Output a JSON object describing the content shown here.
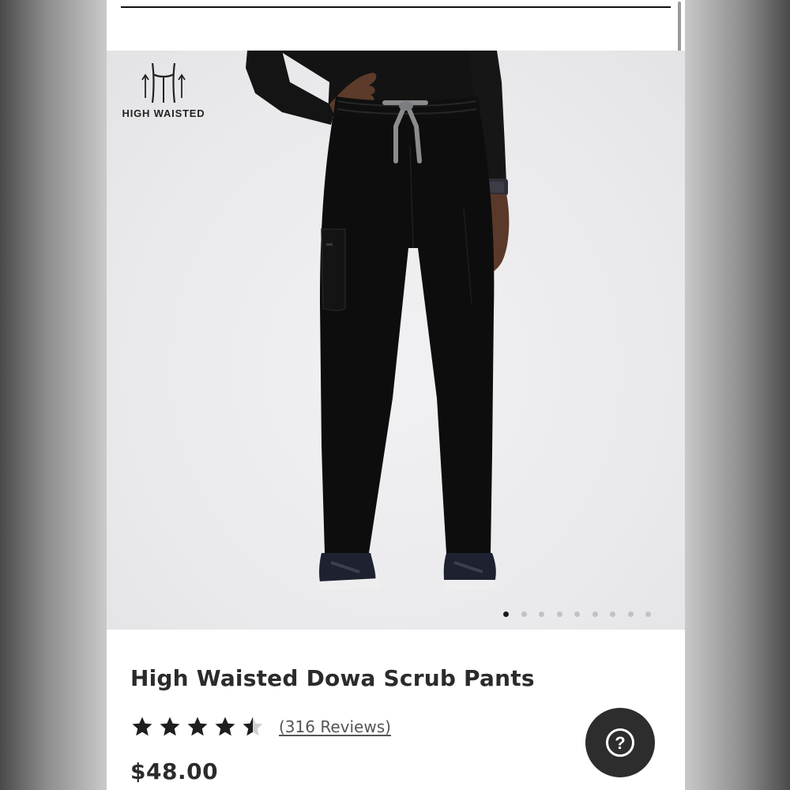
{
  "badge": {
    "label": "HIGH WAISTED",
    "icon": "waist-arrows-icon"
  },
  "product": {
    "title": "High Waisted Dowa Scrub Pants",
    "price": "$48.00",
    "rating": {
      "value": 4.5,
      "max": 5,
      "reviews_label": "(316 Reviews)"
    }
  },
  "carousel": {
    "total": 9,
    "active": 1
  },
  "help": {
    "icon": "question-mark-icon",
    "glyph": "?"
  },
  "colors": {
    "accent": "#2d2d2d",
    "pants": "#0d0d0d",
    "drawstring": "#8a8c8e"
  }
}
